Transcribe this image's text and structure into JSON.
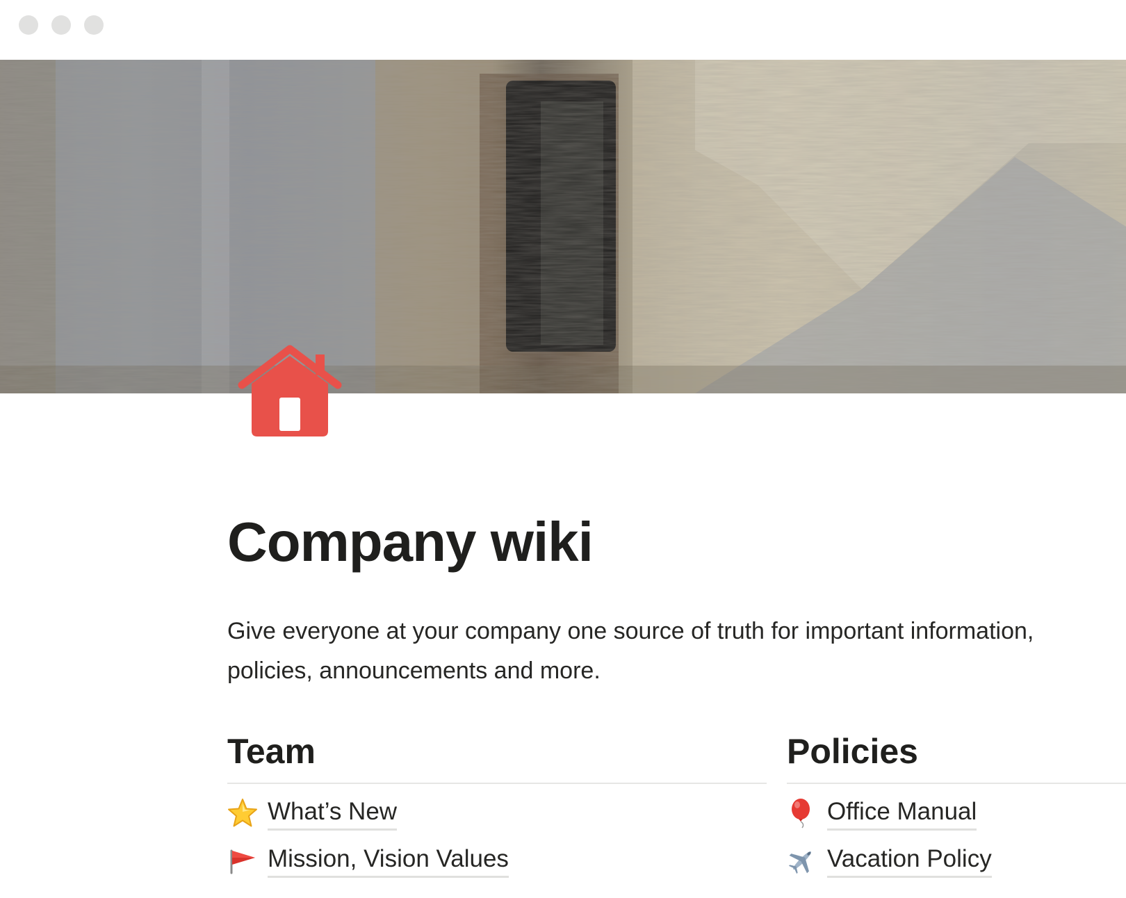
{
  "window": {
    "controls": [
      "close",
      "minimize",
      "zoom"
    ]
  },
  "page": {
    "icon": "house-icon",
    "title": "Company wiki",
    "description": "Give everyone at your company one source of truth for important information, policies, announcements and more."
  },
  "columns": [
    {
      "heading": "Team",
      "items": [
        {
          "icon": "star-icon",
          "label": "What’s New"
        },
        {
          "icon": "red-flag-icon",
          "label": "Mission, Vision Values"
        }
      ]
    },
    {
      "heading": "Policies",
      "items": [
        {
          "icon": "balloon-icon",
          "label": "Office Manual"
        },
        {
          "icon": "airplane-icon",
          "label": "Vacation Policy"
        }
      ]
    }
  ],
  "colors": {
    "icon_red": "#e8514a",
    "text_primary": "#1f1f1d",
    "divider": "#e6e6e4"
  }
}
